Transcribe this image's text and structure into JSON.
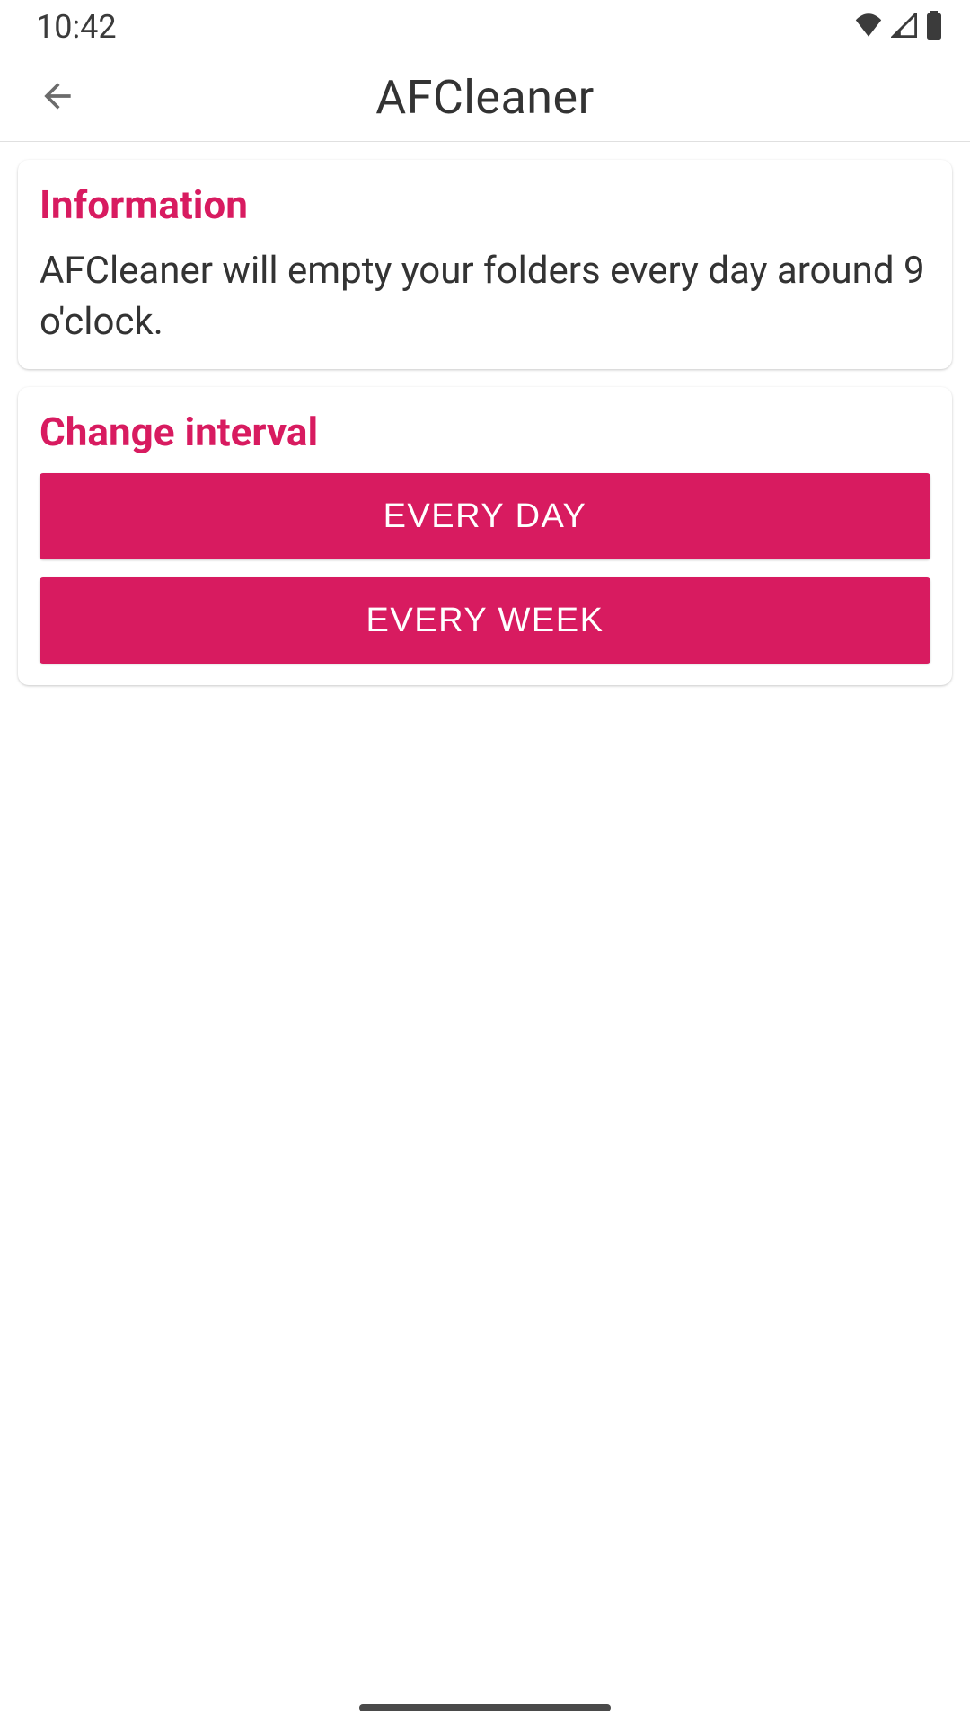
{
  "status": {
    "time": "10:42"
  },
  "header": {
    "title": "AFCleaner"
  },
  "cards": {
    "info": {
      "title": "Information",
      "body": "AFCleaner will empty your folders every day around 9 o'clock."
    },
    "interval": {
      "title": "Change interval",
      "buttons": {
        "day": "EVERY DAY",
        "week": "EVERY WEEK"
      }
    }
  },
  "colors": {
    "accent": "#d81b60",
    "text": "#333333"
  }
}
